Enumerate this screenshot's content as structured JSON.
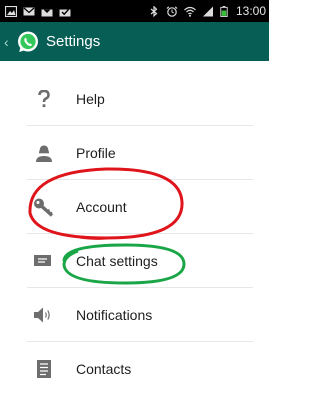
{
  "status_bar": {
    "time": "13:00",
    "icons": [
      "gallery-icon",
      "mail-icon",
      "download-icon",
      "download-check-icon",
      "bluetooth-icon",
      "alarm-icon",
      "wifi-icon",
      "signal-icon",
      "battery-icon"
    ]
  },
  "header": {
    "title": "Settings",
    "logo_icon": "whatsapp-logo-icon",
    "back_icon": "chevron-left-icon"
  },
  "menu": {
    "items": [
      {
        "label": "Help",
        "icon": "help-icon"
      },
      {
        "label": "Profile",
        "icon": "profile-icon"
      },
      {
        "label": "Account",
        "icon": "key-icon"
      },
      {
        "label": "Chat settings",
        "icon": "chat-icon"
      },
      {
        "label": "Notifications",
        "icon": "speaker-icon"
      },
      {
        "label": "Contacts",
        "icon": "contacts-icon"
      }
    ]
  },
  "annotations": {
    "account_highlight_color": "#e0141b",
    "chat_settings_highlight_color": "#1aa646"
  },
  "colors": {
    "action_bar": "#075e54",
    "status_bar": "#000000"
  }
}
